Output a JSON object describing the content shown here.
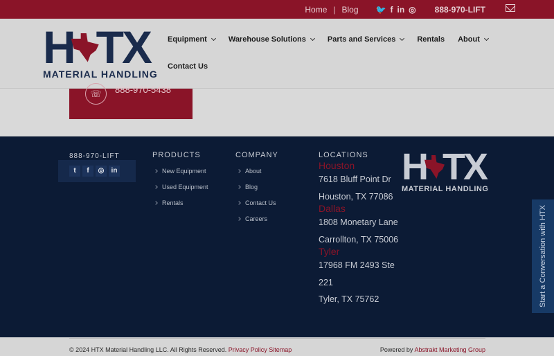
{
  "topbar": {
    "home": "Home",
    "separator": "|",
    "blog": "Blog",
    "social_icons": [
      "twitter-icon",
      "facebook-icon",
      "linkedin-icon",
      "instagram-icon"
    ],
    "twitter_glyph": "🐦",
    "facebook_glyph": "f",
    "linkedin_glyph": "in",
    "instagram_glyph": "◎",
    "phone": "888-970-LIFT"
  },
  "logo": {
    "letters": [
      "H",
      "T",
      "X"
    ],
    "tagline": "MATERIAL HANDLING"
  },
  "nav": {
    "items": [
      {
        "label": "Equipment"
      },
      {
        "label": "Warehouse Solutions"
      },
      {
        "label": "Parts and Services"
      },
      {
        "label": "Rentals"
      },
      {
        "label": "About"
      },
      {
        "label": "Contact Us"
      }
    ]
  },
  "cta": {
    "phone": "888-970-5438",
    "phone_glyph": "☏"
  },
  "footer": {
    "phone": "888-970-LIFT",
    "social": {
      "twitter": "t",
      "facebook": "f",
      "instagram": "◎",
      "linkedin": "in"
    },
    "products": {
      "heading": "PRODUCTS",
      "items": [
        "New Equipment",
        "Used Equipment",
        "Rentals"
      ]
    },
    "company": {
      "heading": "COMPANY",
      "items": [
        "About",
        "Blog",
        "Contact Us",
        "Careers"
      ]
    },
    "locations": {
      "heading": "LOCATIONS",
      "houston": {
        "city": "Houston",
        "line1": "7618 Bluff Point Dr",
        "line2": "Houston, TX 77086"
      },
      "dallas": {
        "city": "Dallas",
        "line1": "1808 Monetary Lane",
        "line2": "Carrollton, TX 75006"
      },
      "tyler": {
        "city": "Tyler",
        "line1": "17968 FM 2493 Ste",
        "line2": "221",
        "line3": "Tyler, TX 75762"
      }
    },
    "logo_tagline": "MATERIAL HANDLING"
  },
  "chat": {
    "label": "Start a Conversation with HTX"
  },
  "bottom": {
    "copyright": "© 2024 HTX Material Handling LLC. All Rights Reserved.",
    "privacy": "Privacy Policy",
    "sitemap": "Sitemap",
    "powered_by": "Powered by",
    "agency": "Abstrakt Marketing Group"
  },
  "colors": {
    "brand_red": "#8a1428",
    "navy": "#0c1b35"
  }
}
